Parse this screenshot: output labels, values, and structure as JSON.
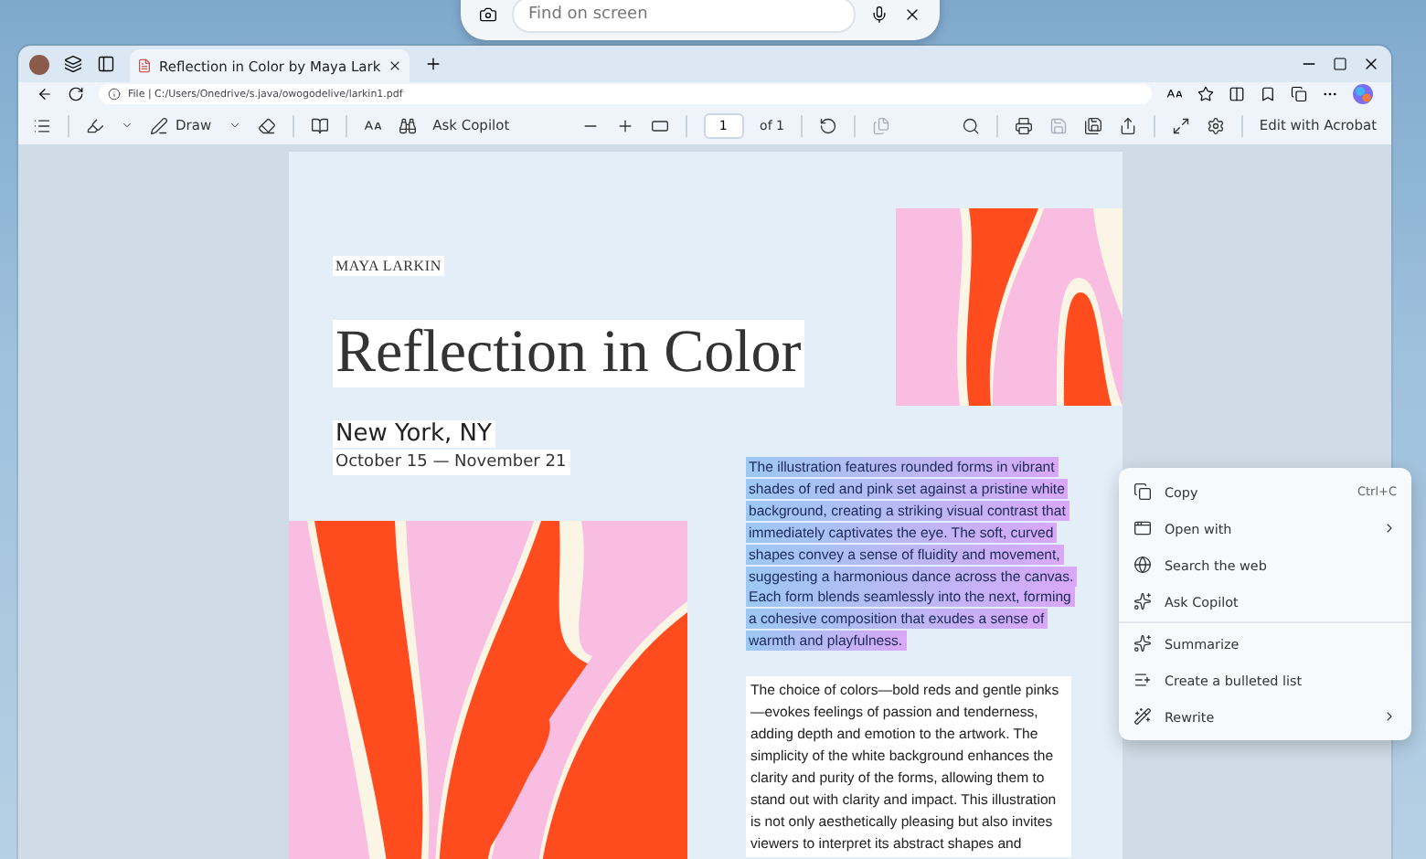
{
  "screen_search": {
    "placeholder": "Find on screen"
  },
  "browser": {
    "tabs": [
      {
        "label": "Reflection in Color by Maya Lark",
        "selected": true
      }
    ],
    "address": "File | C:/Users/Onedrive/s.java/owogodelive/larkin1.pdf",
    "toolbar": {
      "draw_label": "Draw",
      "ask_copilot": "Ask Copilot",
      "page_number": "1",
      "page_count": "of 1",
      "edit_button": "Edit with Acrobat"
    }
  },
  "document": {
    "author": "MAYA LARKIN",
    "title": "Reflection in Color",
    "location": "New York, NY",
    "dates": "October 15 — November 21",
    "selected_paragraph": "The illustration features rounded forms in vibrant shades of red and pink set against a pristine white background, creating a striking visual contrast that immediately captivates the eye. The soft, curved shapes convey a sense of fluidity and movement, suggesting a harmonious dance across the canvas. Each form blends seamlessly into the next, forming a cohesive composition that exudes a sense of warmth and playfulness.",
    "paragraph": "The choice of colors—bold reds and gentle pinks —evokes feelings of passion and tenderness, adding depth and emotion to the artwork. The simplicity of the white background enhances the clarity and purity of the forms, allowing them to stand out with clarity and impact. This illustration is not only aesthetically pleasing but also invites viewers to interpret its abstract shapes and"
  },
  "context_menu": {
    "sections": [
      [
        {
          "kind": "copy",
          "label": "Copy",
          "shortcut": "Ctrl+C",
          "submenu": false
        },
        {
          "kind": "open",
          "label": "Open with",
          "submenu": true
        },
        {
          "kind": "web",
          "label": "Search the web",
          "submenu": false
        },
        {
          "kind": "copilot",
          "label": "Ask Copilot",
          "submenu": false
        }
      ],
      [
        {
          "kind": "summarize",
          "label": "Summarize",
          "submenu": false
        },
        {
          "kind": "list",
          "label": "Create a bulleted list",
          "submenu": false
        },
        {
          "kind": "rewrite",
          "label": "Rewrite",
          "submenu": true
        }
      ]
    ]
  }
}
